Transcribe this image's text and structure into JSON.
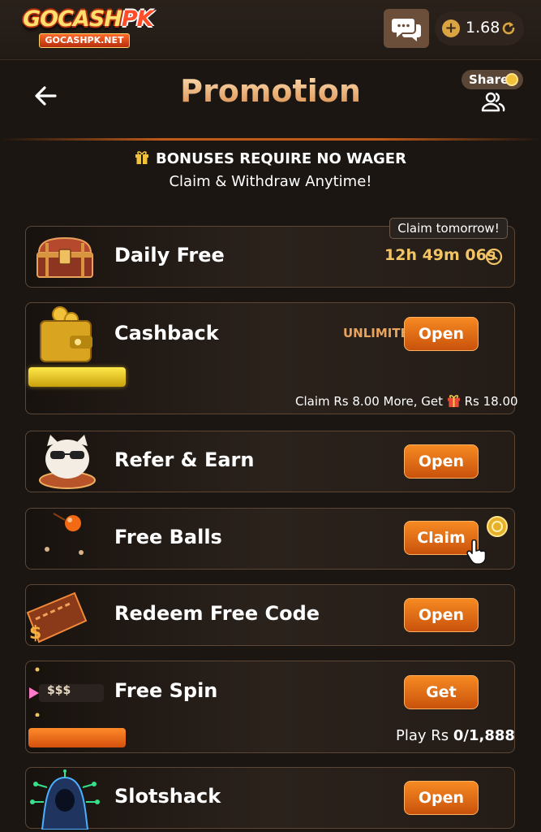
{
  "header": {
    "logo_text_main": "GOCASH",
    "logo_text_accent": "PK",
    "logo_subtext": "GOCASHPK.NET",
    "balance": "1.68",
    "balance_plus": "+"
  },
  "page": {
    "title": "Promotion",
    "share_label": "Share"
  },
  "banner": {
    "headline": "BONUSES REQUIRE NO WAGER",
    "subline": "Claim & Withdraw Anytime!"
  },
  "promotions": {
    "daily_free": {
      "title": "Daily Free",
      "tag": "Claim tomorrow!",
      "timer": "12h 49m 06s"
    },
    "cashback": {
      "title": "Cashback",
      "badge": "UNLIMITED!",
      "button": "Open",
      "info_prefix": "Claim Rs 8.00 More, Get",
      "info_suffix": "Rs 18.00"
    },
    "refer": {
      "title": "Refer & Earn",
      "button": "Open"
    },
    "free_balls": {
      "title": "Free Balls",
      "button": "Claim"
    },
    "redeem": {
      "title": "Redeem Free Code",
      "button": "Open"
    },
    "free_spin": {
      "title": "Free Spin",
      "button": "Get",
      "thumb_text": "$$$",
      "progress_prefix": "Play Rs",
      "progress_value": "0/1,888"
    },
    "slotshack": {
      "title": "Slotshack",
      "button": "Open"
    }
  },
  "colors": {
    "accent_orange": "#f68a22",
    "gold": "#f2c463",
    "background": "#1c1612"
  },
  "icons": [
    "chat-icon",
    "refresh-icon",
    "back-arrow-icon",
    "users-icon",
    "gift-icon",
    "clock-icon",
    "hand-cursor-icon",
    "coin-icon"
  ]
}
